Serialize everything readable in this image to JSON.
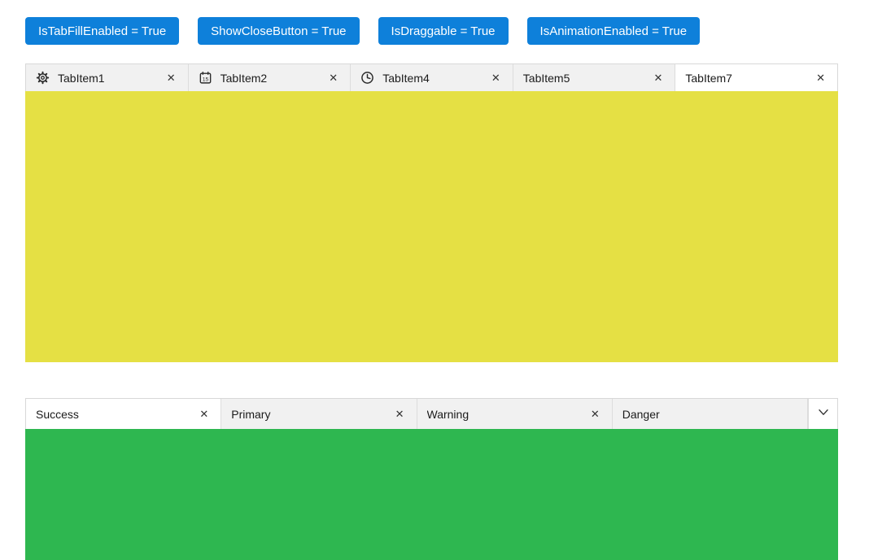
{
  "buttons": [
    "IsTabFillEnabled = True",
    "ShowCloseButton = True",
    "IsDraggable = True",
    "IsAnimationEnabled = True"
  ],
  "top_tabview": {
    "tabs": [
      {
        "label": "TabItem1",
        "icon": "gear-icon",
        "active": false
      },
      {
        "label": "TabItem2",
        "icon": "calendar-icon",
        "active": false
      },
      {
        "label": "TabItem4",
        "icon": "clock-icon",
        "active": false
      },
      {
        "label": "TabItem5",
        "icon": null,
        "active": false
      },
      {
        "label": "TabItem7",
        "icon": null,
        "active": true
      }
    ],
    "content_color": "#e5e044"
  },
  "bottom_tabview": {
    "tabs": [
      {
        "label": "Success",
        "active": true
      },
      {
        "label": "Primary",
        "active": false
      },
      {
        "label": "Warning",
        "active": false
      },
      {
        "label": "Danger",
        "active": false
      }
    ],
    "has_dropdown_button": true,
    "content_color": "#2eb750"
  },
  "glyphs": {
    "close": "✕",
    "calendar_day": "15"
  },
  "colors": {
    "button_blue": "#0e80da",
    "inactive_tab_bg": "#f1f1f1",
    "active_tab_bg": "#ffffff",
    "strip_border": "#d8d8d8",
    "yellow_content": "#e5e044",
    "green_content": "#2eb750"
  }
}
